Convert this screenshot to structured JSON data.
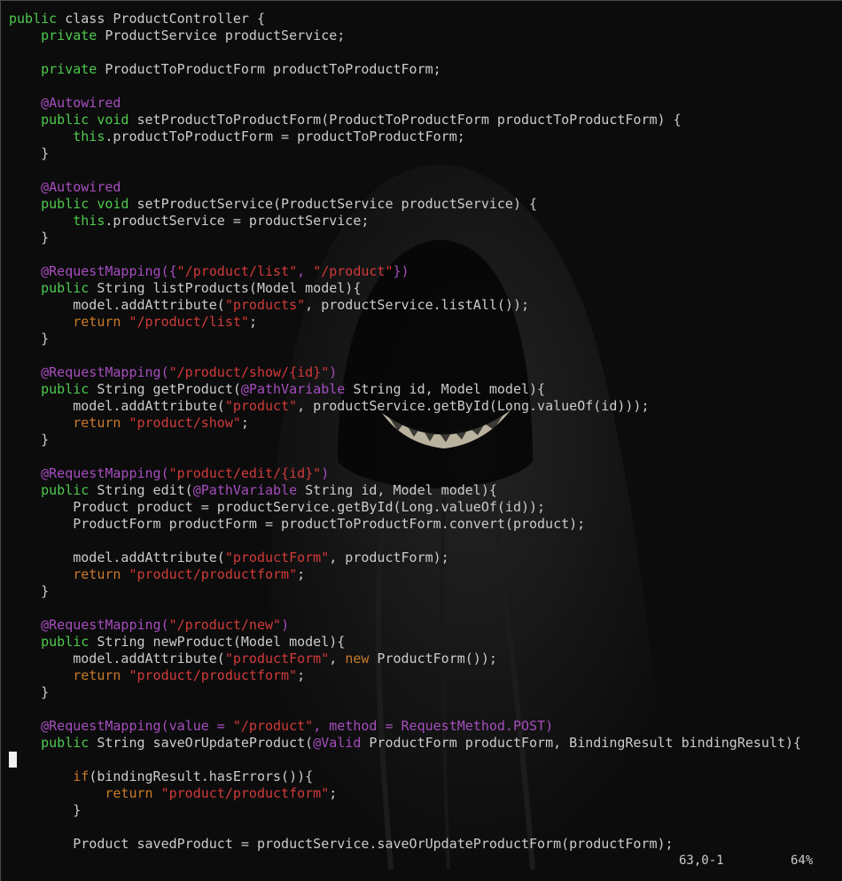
{
  "editor": {
    "status_position": "63,0-1",
    "status_percent": "64%",
    "colors": {
      "background": "#0c0c0c",
      "text": "#cccccc",
      "keyword": "#4ec94e",
      "annotation": "#a64dbf",
      "string": "#d23a3a",
      "return_keyword": "#c97a2b"
    },
    "lines": [
      [
        {
          "c": "kw",
          "t": "public"
        },
        {
          "c": "pl",
          "t": " "
        },
        {
          "c": "pl",
          "t": "class ProductController {"
        }
      ],
      [
        {
          "c": "pl",
          "t": "    "
        },
        {
          "c": "kw",
          "t": "private"
        },
        {
          "c": "pl",
          "t": " ProductService productService;"
        }
      ],
      [],
      [
        {
          "c": "pl",
          "t": "    "
        },
        {
          "c": "kw",
          "t": "private"
        },
        {
          "c": "pl",
          "t": " ProductToProductForm productToProductForm;"
        }
      ],
      [],
      [
        {
          "c": "pl",
          "t": "    "
        },
        {
          "c": "an",
          "t": "@Autowired"
        }
      ],
      [
        {
          "c": "pl",
          "t": "    "
        },
        {
          "c": "kw",
          "t": "public"
        },
        {
          "c": "pl",
          "t": " "
        },
        {
          "c": "ty",
          "t": "void"
        },
        {
          "c": "pl",
          "t": " setProductToProductForm(ProductToProductForm productToProductForm) {"
        }
      ],
      [
        {
          "c": "pl",
          "t": "        "
        },
        {
          "c": "kw",
          "t": "this"
        },
        {
          "c": "pl",
          "t": ".productToProductForm = productToProductForm;"
        }
      ],
      [
        {
          "c": "pl",
          "t": "    }"
        }
      ],
      [],
      [
        {
          "c": "pl",
          "t": "    "
        },
        {
          "c": "an",
          "t": "@Autowired"
        }
      ],
      [
        {
          "c": "pl",
          "t": "    "
        },
        {
          "c": "kw",
          "t": "public"
        },
        {
          "c": "pl",
          "t": " "
        },
        {
          "c": "ty",
          "t": "void"
        },
        {
          "c": "pl",
          "t": " setProductService(ProductService productService) {"
        }
      ],
      [
        {
          "c": "pl",
          "t": "        "
        },
        {
          "c": "kw",
          "t": "this"
        },
        {
          "c": "pl",
          "t": ".productService = productService;"
        }
      ],
      [
        {
          "c": "pl",
          "t": "    }"
        }
      ],
      [],
      [
        {
          "c": "pl",
          "t": "    "
        },
        {
          "c": "an",
          "t": "@RequestMapping({"
        },
        {
          "c": "st",
          "t": "\"/product/list\""
        },
        {
          "c": "an",
          "t": ", "
        },
        {
          "c": "st",
          "t": "\"/product\""
        },
        {
          "c": "an",
          "t": "})"
        }
      ],
      [
        {
          "c": "pl",
          "t": "    "
        },
        {
          "c": "kw",
          "t": "public"
        },
        {
          "c": "pl",
          "t": " String listProducts(Model model){"
        }
      ],
      [
        {
          "c": "pl",
          "t": "        model.addAttribute("
        },
        {
          "c": "st",
          "t": "\"products\""
        },
        {
          "c": "pl",
          "t": ", productService.listAll());"
        }
      ],
      [
        {
          "c": "pl",
          "t": "        "
        },
        {
          "c": "ret",
          "t": "return"
        },
        {
          "c": "pl",
          "t": " "
        },
        {
          "c": "st",
          "t": "\"/product/list\""
        },
        {
          "c": "pl",
          "t": ";"
        }
      ],
      [
        {
          "c": "pl",
          "t": "    }"
        }
      ],
      [],
      [
        {
          "c": "pl",
          "t": "    "
        },
        {
          "c": "an",
          "t": "@RequestMapping("
        },
        {
          "c": "st",
          "t": "\"/product/show/{id}\""
        },
        {
          "c": "an",
          "t": ")"
        }
      ],
      [
        {
          "c": "pl",
          "t": "    "
        },
        {
          "c": "kw",
          "t": "public"
        },
        {
          "c": "pl",
          "t": " String getProduct("
        },
        {
          "c": "an",
          "t": "@PathVariable"
        },
        {
          "c": "pl",
          "t": " String id, Model model){"
        }
      ],
      [
        {
          "c": "pl",
          "t": "        model.addAttribute("
        },
        {
          "c": "st",
          "t": "\"product\""
        },
        {
          "c": "pl",
          "t": ", productService.getById(Long.valueOf(id)));"
        }
      ],
      [
        {
          "c": "pl",
          "t": "        "
        },
        {
          "c": "ret",
          "t": "return"
        },
        {
          "c": "pl",
          "t": " "
        },
        {
          "c": "st",
          "t": "\"product/show\""
        },
        {
          "c": "pl",
          "t": ";"
        }
      ],
      [
        {
          "c": "pl",
          "t": "    }"
        }
      ],
      [],
      [
        {
          "c": "pl",
          "t": "    "
        },
        {
          "c": "an",
          "t": "@RequestMapping("
        },
        {
          "c": "st",
          "t": "\"product/edit/{id}\""
        },
        {
          "c": "an",
          "t": ")"
        }
      ],
      [
        {
          "c": "pl",
          "t": "    "
        },
        {
          "c": "kw",
          "t": "public"
        },
        {
          "c": "pl",
          "t": " String edit("
        },
        {
          "c": "an",
          "t": "@PathVariable"
        },
        {
          "c": "pl",
          "t": " String id, Model model){"
        }
      ],
      [
        {
          "c": "pl",
          "t": "        Product product = productService.getById(Long.valueOf(id));"
        }
      ],
      [
        {
          "c": "pl",
          "t": "        ProductForm productForm = productToProductForm.convert(product);"
        }
      ],
      [],
      [
        {
          "c": "pl",
          "t": "        model.addAttribute("
        },
        {
          "c": "st",
          "t": "\"productForm\""
        },
        {
          "c": "pl",
          "t": ", productForm);"
        }
      ],
      [
        {
          "c": "pl",
          "t": "        "
        },
        {
          "c": "ret",
          "t": "return"
        },
        {
          "c": "pl",
          "t": " "
        },
        {
          "c": "st",
          "t": "\"product/productform\""
        },
        {
          "c": "pl",
          "t": ";"
        }
      ],
      [
        {
          "c": "pl",
          "t": "    }"
        }
      ],
      [],
      [
        {
          "c": "pl",
          "t": "    "
        },
        {
          "c": "an",
          "t": "@RequestMapping("
        },
        {
          "c": "st",
          "t": "\"/product/new\""
        },
        {
          "c": "an",
          "t": ")"
        }
      ],
      [
        {
          "c": "pl",
          "t": "    "
        },
        {
          "c": "kw",
          "t": "public"
        },
        {
          "c": "pl",
          "t": " String newProduct(Model model){"
        }
      ],
      [
        {
          "c": "pl",
          "t": "        model.addAttribute("
        },
        {
          "c": "st",
          "t": "\"productForm\""
        },
        {
          "c": "pl",
          "t": ", "
        },
        {
          "c": "nw",
          "t": "new"
        },
        {
          "c": "pl",
          "t": " ProductForm());"
        }
      ],
      [
        {
          "c": "pl",
          "t": "        "
        },
        {
          "c": "ret",
          "t": "return"
        },
        {
          "c": "pl",
          "t": " "
        },
        {
          "c": "st",
          "t": "\"product/productform\""
        },
        {
          "c": "pl",
          "t": ";"
        }
      ],
      [
        {
          "c": "pl",
          "t": "    }"
        }
      ],
      [],
      [
        {
          "c": "pl",
          "t": "    "
        },
        {
          "c": "an",
          "t": "@RequestMapping(value = "
        },
        {
          "c": "st",
          "t": "\"/product\""
        },
        {
          "c": "an",
          "t": ", method = RequestMethod.POST)"
        }
      ],
      [
        {
          "c": "pl",
          "t": "    "
        },
        {
          "c": "kw",
          "t": "public"
        },
        {
          "c": "pl",
          "t": " String saveOrUpdateProduct("
        },
        {
          "c": "an",
          "t": "@Valid"
        },
        {
          "c": "pl",
          "t": " ProductForm productForm, BindingResult bindingResult){"
        }
      ],
      [],
      [
        {
          "c": "pl",
          "t": "        "
        },
        {
          "c": "ret",
          "t": "if"
        },
        {
          "c": "pl",
          "t": "(bindingResult.hasErrors()){"
        }
      ],
      [
        {
          "c": "pl",
          "t": "            "
        },
        {
          "c": "ret",
          "t": "return"
        },
        {
          "c": "pl",
          "t": " "
        },
        {
          "c": "st",
          "t": "\"product/productform\""
        },
        {
          "c": "pl",
          "t": ";"
        }
      ],
      [
        {
          "c": "pl",
          "t": "        }"
        }
      ],
      [],
      [
        {
          "c": "pl",
          "t": "        Product savedProduct = productService.saveOrUpdateProductForm(productForm);"
        }
      ]
    ]
  }
}
